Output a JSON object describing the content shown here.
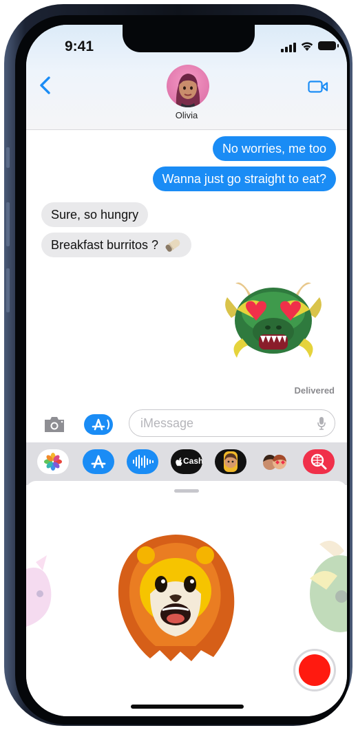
{
  "status_bar": {
    "time": "9:41"
  },
  "header": {
    "contact_name": "Olivia"
  },
  "messages": [
    {
      "text": "No worries, me too",
      "direction": "outgoing"
    },
    {
      "text": "Wanna just go straight to eat?",
      "direction": "outgoing"
    },
    {
      "text": "Sure, so hungry",
      "direction": "incoming"
    },
    {
      "text": "Breakfast burritos ?",
      "direction": "incoming"
    }
  ],
  "sticker": {
    "icon": "dragon-memoji-heart-eyes-icon",
    "status": "Delivered"
  },
  "composer": {
    "placeholder": "iMessage"
  },
  "app_strip": [
    {
      "icon": "photos-icon"
    },
    {
      "icon": "app-store-icon"
    },
    {
      "icon": "audio-message-icon"
    },
    {
      "icon": "apple-cash-icon",
      "label": "Cash"
    },
    {
      "icon": "memoji-icon"
    },
    {
      "icon": "memoji-stickers-icon"
    },
    {
      "icon": "web-images-search-icon"
    }
  ],
  "memoji_drawer": {
    "selected": "lion-memoji-icon"
  },
  "colors": {
    "accent": "#1a8cf5",
    "incoming_bubble": "#e9e9eb",
    "record": "#ff1a10"
  }
}
